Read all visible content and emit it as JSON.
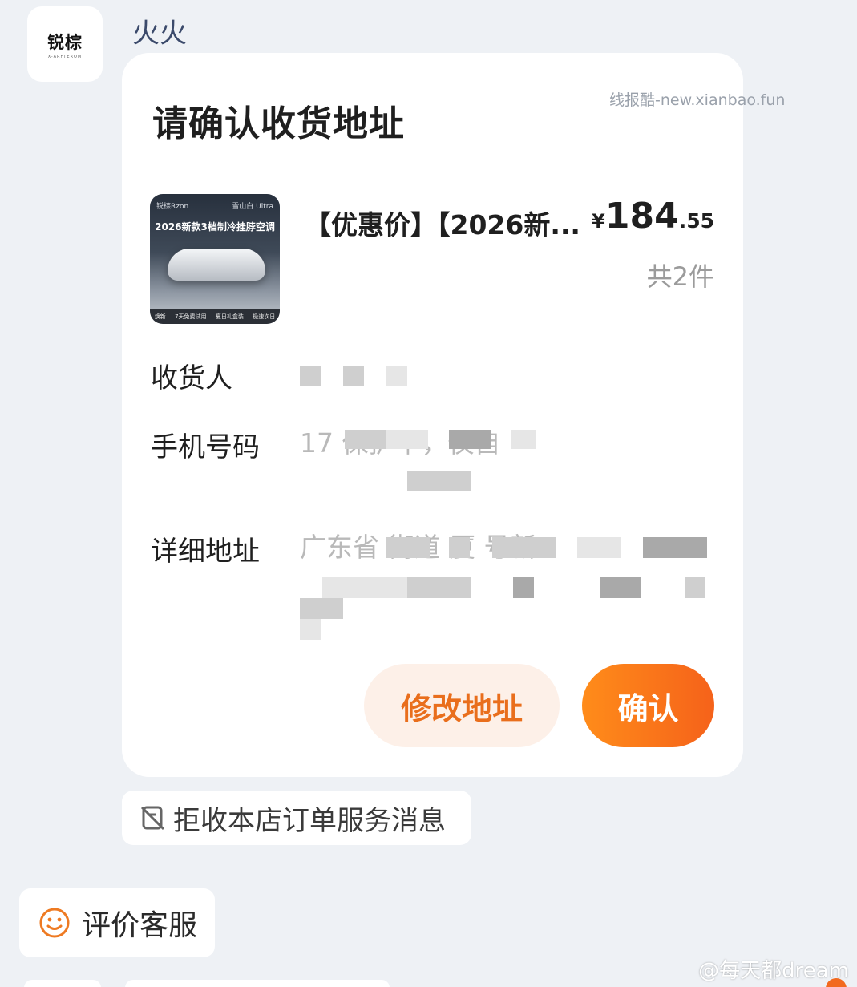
{
  "sender": {
    "avatar_logo": "锐棕",
    "avatar_sub": "X-ARFTEROM",
    "name": "火火"
  },
  "watermarks": {
    "top": "线报酷-new.xianbao.fun",
    "bottom": "@每天都dream"
  },
  "card": {
    "title": "请确认收货地址",
    "product": {
      "image_brand": "锐棕Rzon",
      "image_tag": "雪山白 Ultra",
      "image_headline": "2026新款3档制冷挂脖空调",
      "image_features": [
        "焕新",
        "7天免费试用",
        "夏日礼盒装",
        "极速次日"
      ],
      "name": "【优惠价】【2026新...",
      "price_currency": "¥",
      "price_integer": "184",
      "price_decimal": ".55",
      "quantity": "共2件"
    },
    "fields": [
      {
        "label": "收货人",
        "value": ""
      },
      {
        "label": "手机号码",
        "value": "17          保护中，仅自"
      },
      {
        "label": "详细地址",
        "value": "广东省        街道 厦          号新"
      }
    ],
    "buttons": {
      "modify": "修改地址",
      "confirm": "确认"
    }
  },
  "actions": {
    "reject": "拒收本店订单服务消息",
    "rate": "评价客服"
  },
  "colors": {
    "accent": "#f5621a",
    "modify_bg": "#fdf0e8",
    "background": "#eef1f5"
  }
}
